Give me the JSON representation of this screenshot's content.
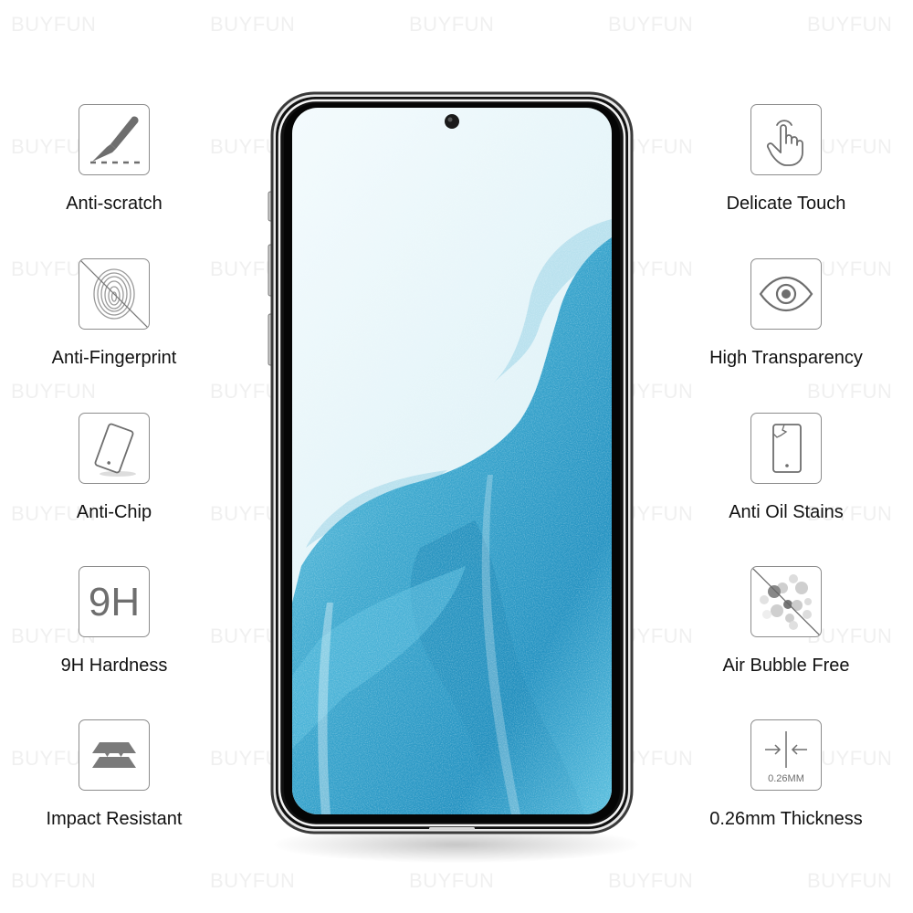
{
  "watermark": "BUYFUN",
  "features_left": [
    {
      "label": "Anti-scratch",
      "icon": "scalpel-icon"
    },
    {
      "label": "Anti-Fingerprint",
      "icon": "fingerprint-crossed-icon"
    },
    {
      "label": "Anti-Chip",
      "icon": "tilted-phone-icon"
    },
    {
      "label": "9H Hardness",
      "icon": "9h-icon",
      "icon_text": "9H"
    },
    {
      "label": "Impact Resistant",
      "icon": "layers-impact-icon"
    }
  ],
  "features_right": [
    {
      "label": "Delicate Touch",
      "icon": "touch-hand-icon"
    },
    {
      "label": "High Transparency",
      "icon": "eye-icon"
    },
    {
      "label": "Anti Oil Stains",
      "icon": "cracked-phone-icon"
    },
    {
      "label": "Air Bubble Free",
      "icon": "bubbles-crossed-icon"
    },
    {
      "label": "0.26mm Thickness",
      "icon": "thickness-icon",
      "icon_text": "0.26MM"
    }
  ],
  "colors": {
    "icon_gray": "#6e6e6e",
    "label_text": "#111111",
    "screen_light": "#eef8fb",
    "wave_blue": "#3ea9cf",
    "wave_dark": "#1b86b5"
  }
}
